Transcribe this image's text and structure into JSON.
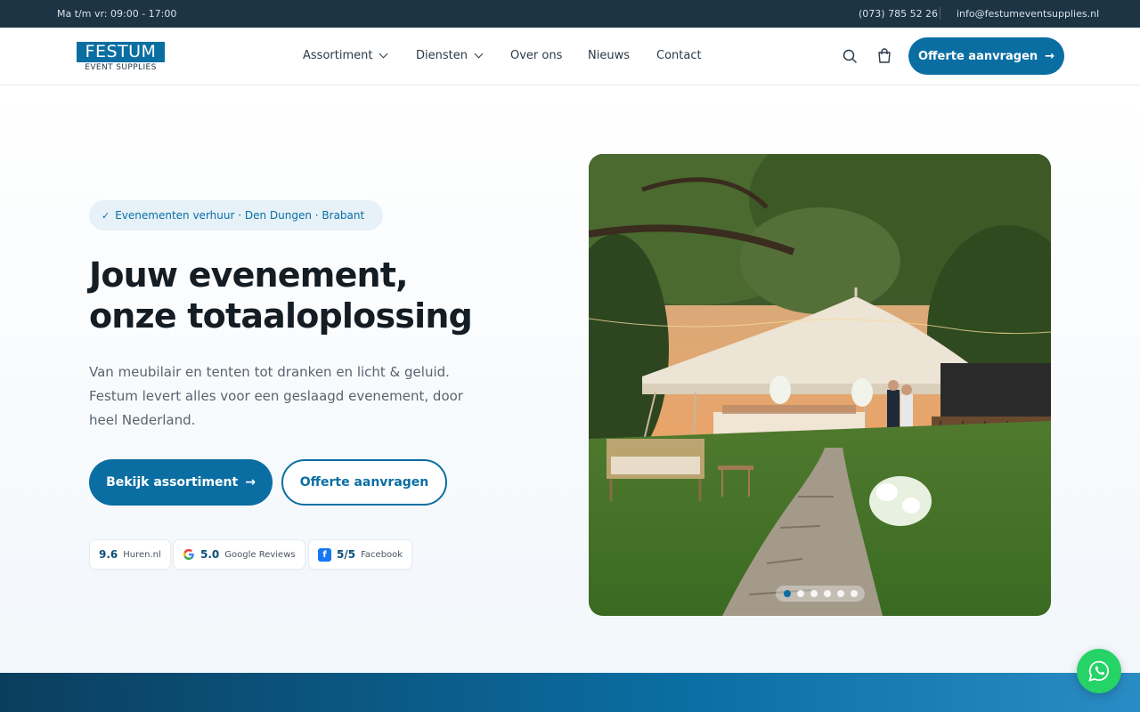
{
  "topbar": {
    "hours": "Ma t/m vr: 09:00 - 17:00",
    "phone": "(073) 785 52 26",
    "email": "info@festumeventsupplies.nl"
  },
  "logo": {
    "name": "FESTUM",
    "tagline": "EVENT SUPPLIES"
  },
  "nav": {
    "items": [
      {
        "label": "Assortiment",
        "has_dropdown": true
      },
      {
        "label": "Diensten",
        "has_dropdown": true
      },
      {
        "label": "Over ons",
        "has_dropdown": false
      },
      {
        "label": "Nieuws",
        "has_dropdown": false
      },
      {
        "label": "Contact",
        "has_dropdown": false
      }
    ],
    "search_icon": "search-icon",
    "cart_icon": "shopping-bag-icon",
    "cta_label": "Offerte aanvragen",
    "cta_arrow": "→"
  },
  "hero": {
    "pill": "Evenementen verhuur · Den Dungen · Brabant",
    "pill_check": "✓",
    "title_line1": "Jouw evenement,",
    "title_line2": "onze totaaloplossing",
    "lead": "Van meubilair en tenten tot dranken en licht & geluid. Festum levert alles voor een geslaagd evenement, door heel Nederland.",
    "primary_button": "Bekijk assortiment",
    "primary_arrow": "→",
    "secondary_button": "Offerte aanvragen",
    "ratings": [
      {
        "score": "9.6",
        "source": "Huren.nl"
      },
      {
        "score": "5.0",
        "source": "Google Reviews"
      },
      {
        "score": "5/5",
        "source": "Facebook"
      }
    ]
  },
  "carousel": {
    "slide_count": 6,
    "active_index": 0
  },
  "colors": {
    "brand": "#0b6ea3",
    "topbar": "#1c3444",
    "whatsapp": "#25d366"
  }
}
